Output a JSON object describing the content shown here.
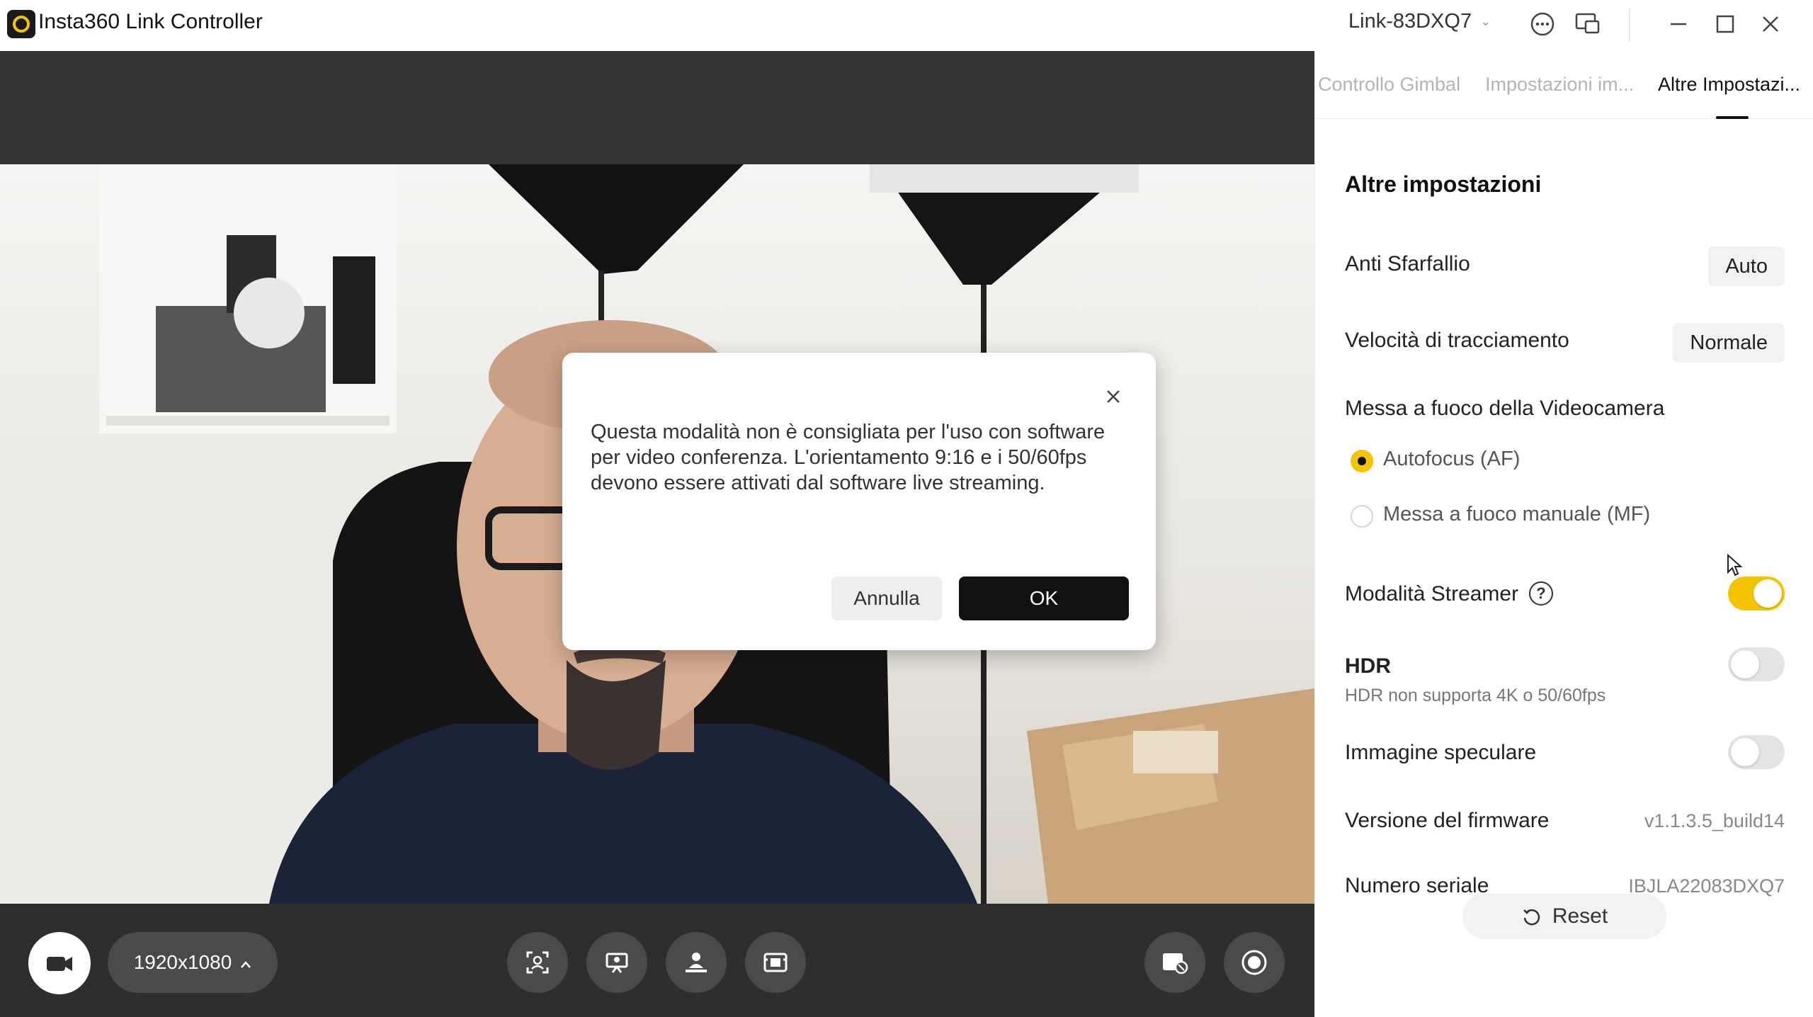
{
  "window": {
    "title": "Insta360 Link Controller",
    "device": "Link-83DXQ7"
  },
  "tabs": [
    {
      "label": "Controllo Gimbal",
      "active": false
    },
    {
      "label": "Impostazioni im...",
      "active": false
    },
    {
      "label": "Altre Impostazi...",
      "active": true
    }
  ],
  "settings": {
    "section_title": "Altre impostazioni",
    "anti_flicker": {
      "label": "Anti Sfarfallio",
      "value": "Auto"
    },
    "tracking_speed": {
      "label": "Velocità di tracciamento",
      "value": "Normale"
    },
    "focus": {
      "label": "Messa a fuoco della Videocamera",
      "options": [
        {
          "label": "Autofocus (AF)",
          "selected": true
        },
        {
          "label": "Messa a fuoco manuale (MF)",
          "selected": false
        }
      ]
    },
    "streamer_mode": {
      "label": "Modalità Streamer",
      "on": true
    },
    "hdr": {
      "label": "HDR",
      "note": "HDR non supporta 4K o 50/60fps",
      "on": false
    },
    "mirror": {
      "label": "Immagine speculare",
      "on": false
    },
    "firmware": {
      "label": "Versione del firmware",
      "value": "v1.1.3.5_build14"
    },
    "serial": {
      "label": "Numero seriale",
      "value": "IBJLA22083DXQ7"
    },
    "reset_label": "Reset"
  },
  "toolbar": {
    "resolution": "1920x1080"
  },
  "dialog": {
    "message": "Questa modalità non è consigliata per l'uso con software per video conferenza. L'orientamento 9:16 e i 50/60fps devono essere attivati dal software live streaming.",
    "cancel_label": "Annulla",
    "ok_label": "OK"
  },
  "colors": {
    "accent": "#f5c400",
    "dark": "#111111",
    "toolbar_bg": "#2e2e2e"
  }
}
